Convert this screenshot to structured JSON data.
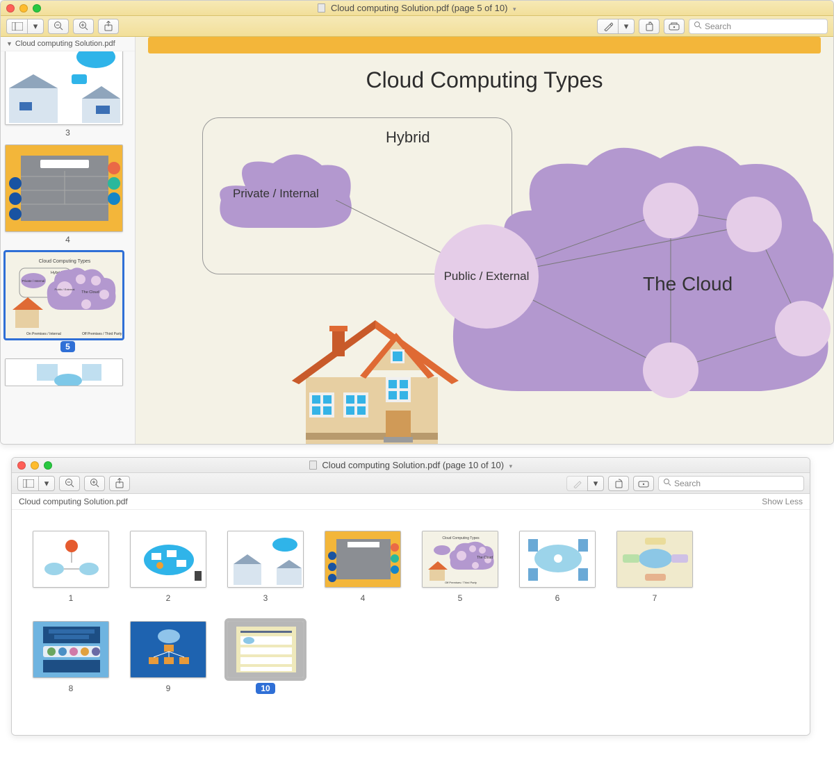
{
  "window1": {
    "title": "Cloud computing Solution.pdf (page 5 of 10)",
    "search_placeholder": "Search",
    "sidebar_filename": "Cloud computing Solution.pdf",
    "thumbs": {
      "t3": "3",
      "t4": "4",
      "t5": "5"
    }
  },
  "page5": {
    "title": "Cloud Computing Types",
    "hybrid": "Hybrid",
    "private": "Private / Internal",
    "public": "Public / External",
    "thecloud": "The Cloud"
  },
  "window2": {
    "title": "Cloud computing Solution.pdf (page 10 of 10)",
    "search_placeholder": "Search",
    "filename": "Cloud computing Solution.pdf",
    "show_less": "Show Less",
    "thumbs": [
      "1",
      "2",
      "3",
      "4",
      "5",
      "6",
      "7",
      "8",
      "9",
      "10"
    ]
  }
}
